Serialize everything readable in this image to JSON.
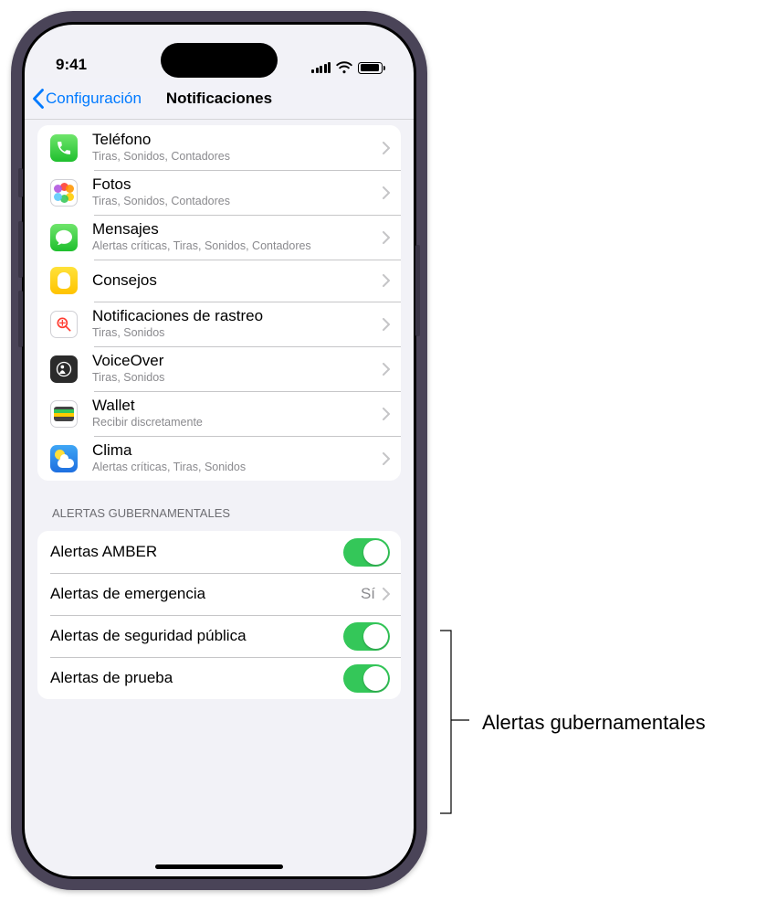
{
  "status": {
    "time": "9:41"
  },
  "nav": {
    "back": "Configuración",
    "title": "Notificaciones"
  },
  "apps": [
    {
      "name": "Teléfono",
      "sub": "Tiras, Sonidos, Contadores",
      "icon": "phone"
    },
    {
      "name": "Fotos",
      "sub": "Tiras, Sonidos, Contadores",
      "icon": "photos"
    },
    {
      "name": "Mensajes",
      "sub": "Alertas críticas, Tiras, Sonidos, Contadores",
      "icon": "messages"
    },
    {
      "name": "Consejos",
      "sub": "",
      "icon": "tips"
    },
    {
      "name": "Notificaciones de rastreo",
      "sub": "Tiras, Sonidos",
      "icon": "tracking"
    },
    {
      "name": "VoiceOver",
      "sub": "Tiras, Sonidos",
      "icon": "voiceover"
    },
    {
      "name": "Wallet",
      "sub": "Recibir discretamente",
      "icon": "wallet"
    },
    {
      "name": "Clima",
      "sub": "Alertas críticas, Tiras, Sonidos",
      "icon": "weather"
    }
  ],
  "gov": {
    "header": "Alertas gubernamentales",
    "rows": [
      {
        "label": "Alertas AMBER",
        "type": "toggle",
        "on": true
      },
      {
        "label": "Alertas de emergencia",
        "type": "link",
        "value": "Sí"
      },
      {
        "label": "Alertas de seguridad pública",
        "type": "toggle",
        "on": true
      },
      {
        "label": "Alertas de prueba",
        "type": "toggle",
        "on": true
      }
    ]
  },
  "callout": {
    "label": "Alertas gubernamentales"
  }
}
